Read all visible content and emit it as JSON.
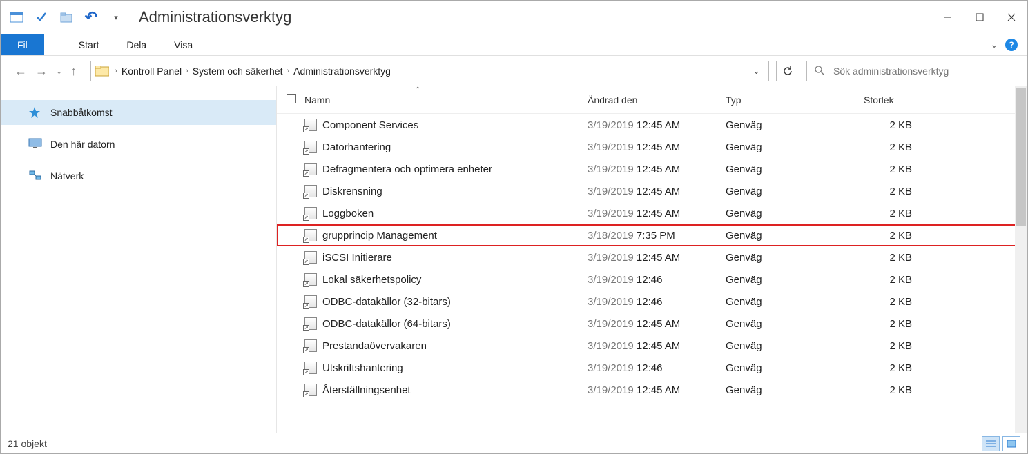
{
  "window_title": "Administrationsverktyg",
  "ribbon": {
    "file": "Fil",
    "tabs": [
      "Start",
      "Dela",
      "Visa"
    ]
  },
  "breadcrumbs": [
    "Kontroll  Panel",
    "System och säkerhet",
    "Administrationsverktyg"
  ],
  "search_placeholder": "Sök administrationsverktyg",
  "sidebar": {
    "items": [
      {
        "label": "Snabbåtkomst"
      },
      {
        "label": "Den här datorn"
      },
      {
        "label": "Nätverk"
      }
    ]
  },
  "columns": {
    "name": "Namn",
    "date": "Ändrad den",
    "type": "Typ",
    "size": "Storlek"
  },
  "rows": [
    {
      "name": "Component Services",
      "date": "3/19/2019",
      "time": "12:45 AM",
      "type": "Genväg",
      "size": "2 KB"
    },
    {
      "name": "Datorhantering",
      "date": "3/19/2019",
      "time": "12:45 AM",
      "type": "Genväg",
      "size": "2 KB"
    },
    {
      "name": "Defragmentera och optimera enheter",
      "date": "3/19/2019",
      "time": "12:45 AM",
      "type": "Genväg",
      "size": "2 KB"
    },
    {
      "name": "Diskrensning",
      "date": "3/19/2019",
      "time": "12:45 AM",
      "type": "Genväg",
      "size": "2 KB"
    },
    {
      "name": "Loggboken",
      "date": "3/19/2019",
      "time": "12:45 AM",
      "type": "Genväg",
      "size": "2 KB"
    },
    {
      "name": "grupprincip Management",
      "date": "3/18/2019",
      "time": "7:35 PM",
      "type": "Genväg",
      "size": "2 KB",
      "highlight": true
    },
    {
      "name": "iSCSI Initierare",
      "date": "3/19/2019",
      "time": "12:45 AM",
      "type": "Genväg",
      "size": "2 KB"
    },
    {
      "name": "Lokal säkerhetspolicy",
      "date": "3/19/2019",
      "time": "12:46",
      "type": "Genväg",
      "size": "2 KB"
    },
    {
      "name": "ODBC-datakällor (32-bitars)",
      "date": "3/19/2019",
      "time": "12:46",
      "type": "Genväg",
      "size": "2 KB"
    },
    {
      "name": "ODBC-datakällor (64-bitars)",
      "date": "3/19/2019",
      "time": "12:45 AM",
      "type": "Genväg",
      "size": "2 KB"
    },
    {
      "name": "Prestandaövervakaren",
      "date": "3/19/2019",
      "time": "12:45 AM",
      "type": "Genväg",
      "size": "2 KB"
    },
    {
      "name": "Utskriftshantering",
      "date": "3/19/2019",
      "time": "12:46",
      "type": "Genväg",
      "size": "2 KB"
    },
    {
      "name": "Återställningsenhet",
      "date": "3/19/2019",
      "time": "12:45 AM",
      "type": "Genväg",
      "size": "2 KB"
    }
  ],
  "status": {
    "count": "21",
    "label": "objekt"
  }
}
